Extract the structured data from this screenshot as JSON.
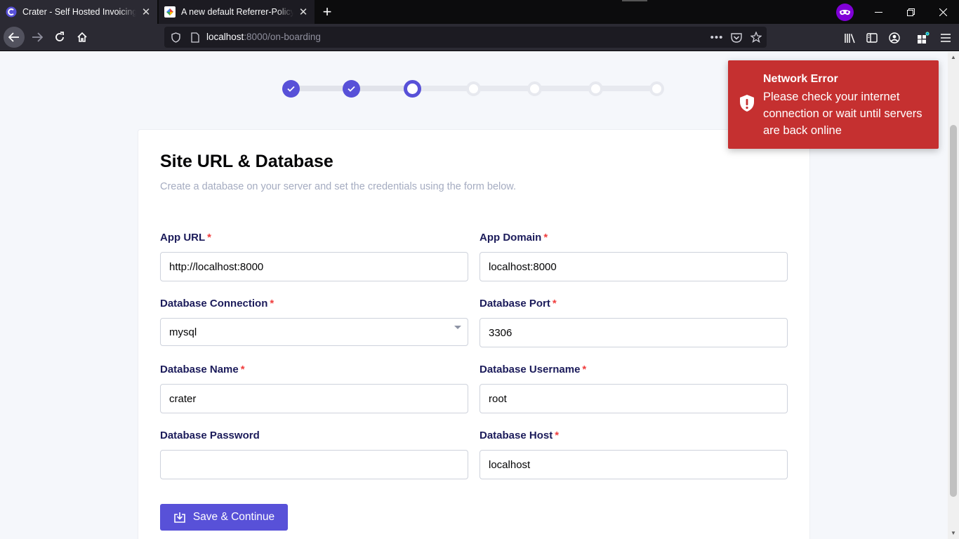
{
  "browser": {
    "tabs": [
      {
        "title": "Crater - Self Hosted Invoicing Platform"
      },
      {
        "title": "A new default Referrer-Policy for Chrome"
      }
    ],
    "url_host": "localhost",
    "url_rest": ":8000/on-boarding"
  },
  "stepper": {
    "total_steps": 7,
    "completed_steps": 2,
    "current_step": 3,
    "accent_color": "#5851d8"
  },
  "form": {
    "title": "Site URL & Database",
    "description": "Create a database on your server and set the credentials using the form below.",
    "fields": [
      {
        "label": "App URL",
        "value": "http://localhost:8000",
        "required": "*"
      },
      {
        "label": "App Domain",
        "value": "localhost:8000",
        "required": "*"
      },
      {
        "label": "Database Connection",
        "value": "mysql",
        "required": "*"
      },
      {
        "label": "Database Port",
        "value": "3306",
        "required": "*"
      },
      {
        "label": "Database Name",
        "value": "crater",
        "required": "*"
      },
      {
        "label": "Database Username",
        "value": "root",
        "required": "*"
      },
      {
        "label": "Database Password",
        "value": ""
      },
      {
        "label": "Database Host",
        "value": "localhost",
        "required": "*"
      }
    ],
    "save_label": "Save & Continue"
  },
  "toast": {
    "title": "Network Error",
    "message": "Please check your internet connection or wait until servers are back online",
    "color": "#c53030"
  }
}
